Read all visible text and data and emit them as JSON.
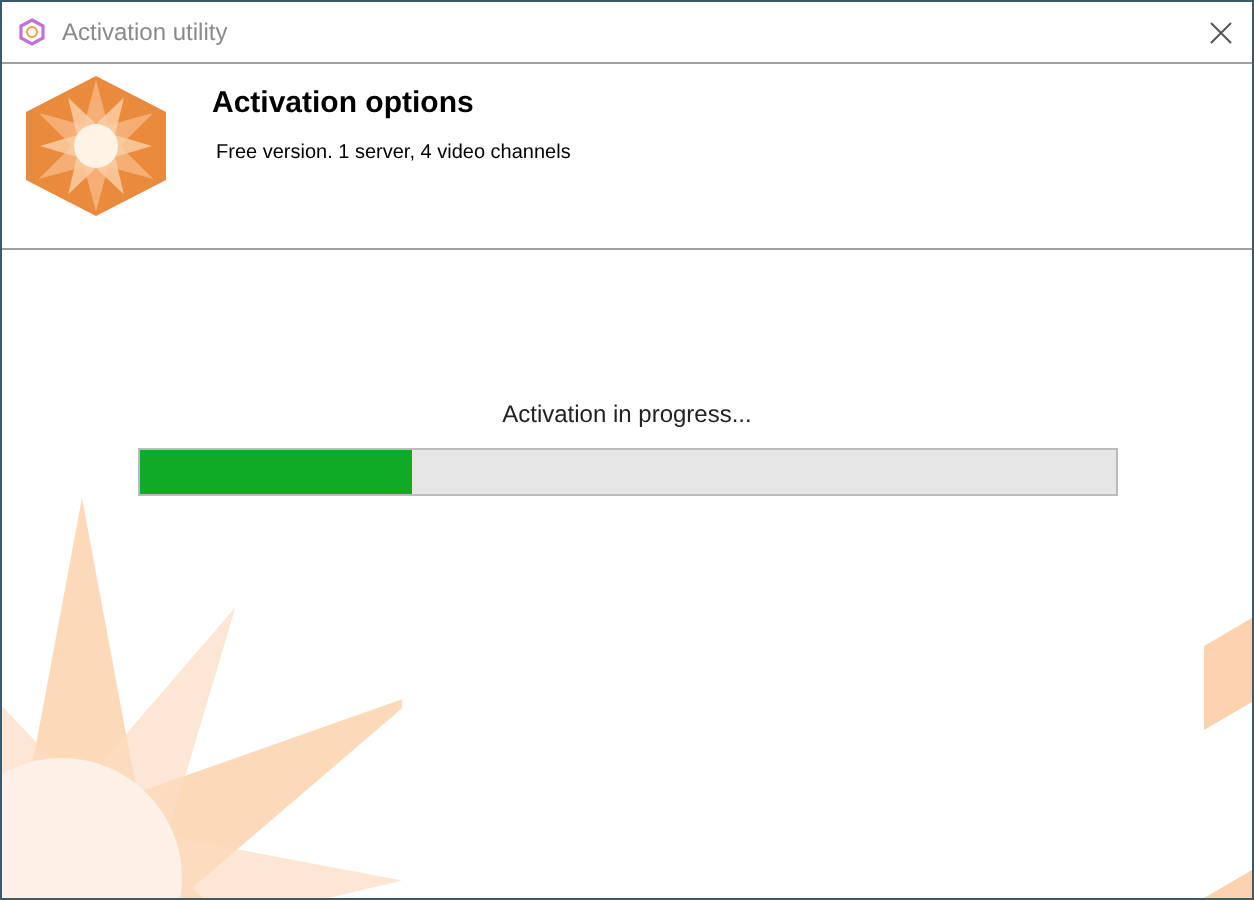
{
  "window": {
    "title": "Activation utility"
  },
  "header": {
    "title": "Activation options",
    "subtitle": "Free version. 1 server, 4 video channels"
  },
  "progress": {
    "label": "Activation in progress...",
    "level": 0.28
  }
}
